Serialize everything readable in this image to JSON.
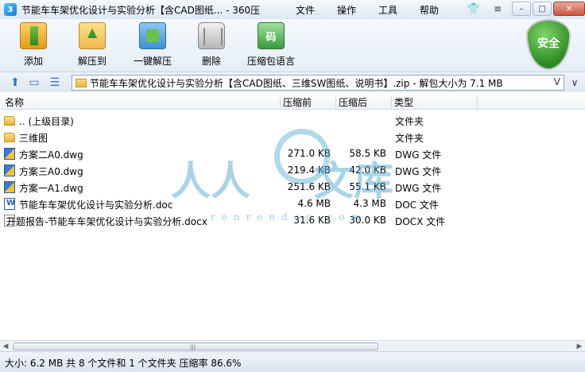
{
  "titlebar": {
    "title": "节能车车架优化设计与实验分析【含CAD图纸... - 360压缩",
    "menu": [
      "文件",
      "操作",
      "工具",
      "帮助"
    ],
    "controls": {
      "minimize": "–",
      "maximize": "□",
      "close": "✕"
    }
  },
  "toolbar": {
    "buttons": [
      {
        "label": "添加",
        "icon": "add-archive-icon"
      },
      {
        "label": "解压到",
        "icon": "extract-to-icon"
      },
      {
        "label": "一键解压",
        "icon": "one-click-extract-icon"
      },
      {
        "label": "删除",
        "icon": "delete-trash-icon"
      },
      {
        "label": "压缩包语言",
        "icon": "codepage-icon",
        "glyph": "码"
      }
    ],
    "security_label": "安全"
  },
  "addressbar": {
    "path": "节能车车架优化设计与实验分析【含CAD图纸、三维SW图纸、说明书】.zip - 解包大小为 7.1 MB",
    "dropdown_glyph": "V",
    "side_glyph": "∨"
  },
  "columns": {
    "name": "名称",
    "size": "压缩前",
    "packed": "压缩后",
    "type": "类型"
  },
  "files": [
    {
      "name": ".. (上级目录)",
      "size": "",
      "packed": "",
      "type": "文件夹",
      "icon": "folder"
    },
    {
      "name": "三维图",
      "size": "",
      "packed": "",
      "type": "文件夹",
      "icon": "folder"
    },
    {
      "name": "方案二A0.dwg",
      "size": "271.0 KB",
      "packed": "58.5 KB",
      "type": "DWG 文件",
      "icon": "dwg"
    },
    {
      "name": "方案三A0.dwg",
      "size": "219.4 KB",
      "packed": "42.0 KB",
      "type": "DWG 文件",
      "icon": "dwg"
    },
    {
      "name": "方案一A1.dwg",
      "size": "251.6 KB",
      "packed": "55.1 KB",
      "type": "DWG 文件",
      "icon": "dwg"
    },
    {
      "name": "节能车车架优化设计与实验分析.doc",
      "size": "4.6 MB",
      "packed": "4.3 MB",
      "type": "DOC 文件",
      "icon": "doc"
    },
    {
      "name": "开题报告-节能车车架优化设计与实验分析.docx",
      "size": "31.6 KB",
      "packed": "30.0 KB",
      "type": "DOCX 文件",
      "icon": "docx"
    }
  ],
  "watermark": {
    "text_left": "人人",
    "text_right": "文库",
    "url": "renrendoc.com"
  },
  "status": {
    "text": "大小: 6.2 MB 共 8 个文件和 1 个文件夹 压缩率 86.6%"
  },
  "colors": {
    "accent": "#2a73c8",
    "shield_green": "#2c8a22",
    "watermark": "#54aad2"
  }
}
